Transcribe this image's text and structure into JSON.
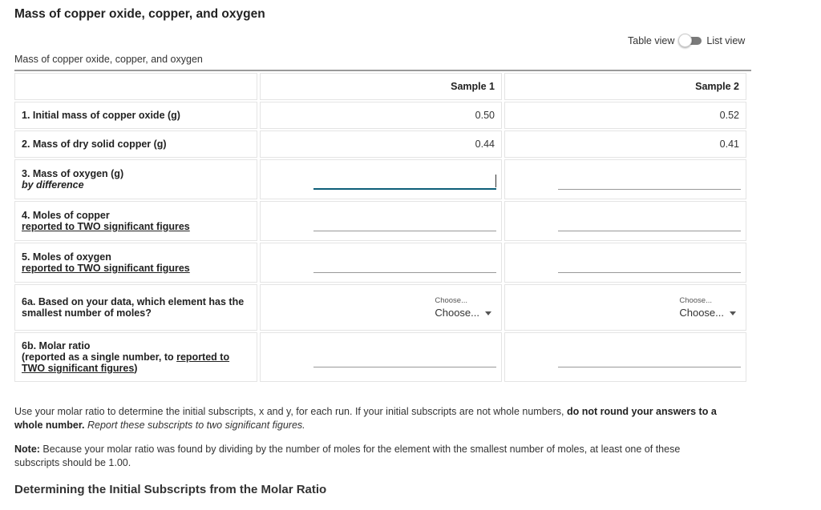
{
  "page": {
    "title": "Mass of copper oxide, copper, and oxygen"
  },
  "view_toggle": {
    "left_label": "Table view",
    "right_label": "List view",
    "state": "table"
  },
  "table": {
    "caption": "Mass of copper oxide, copper, and oxygen",
    "columns": [
      "",
      "Sample 1",
      "Sample 2"
    ],
    "rows": [
      {
        "label": "1. Initial mass of copper oxide (g)",
        "sample1": "0.50",
        "sample2": "0.52"
      },
      {
        "label": "2. Mass of dry solid copper (g)",
        "sample1": "0.44",
        "sample2": "0.41"
      },
      {
        "label": "3. Mass of oxygen (g)",
        "sublabel": "by difference",
        "sample1": "",
        "sample2": ""
      },
      {
        "label": "4. Moles of copper",
        "sublabel": "reported to TWO significant figures",
        "sample1": "",
        "sample2": ""
      },
      {
        "label": "5. Moles of oxygen",
        "sublabel": "reported to TWO significant figures",
        "sample1": "",
        "sample2": ""
      },
      {
        "label": "6a. Based on your data, which element has the smallest number of moles?",
        "sample1_select": {
          "mini_label": "Choose...",
          "value": "Choose..."
        },
        "sample2_select": {
          "mini_label": "Choose...",
          "value": "Choose..."
        }
      },
      {
        "label": "6b. Molar ratio",
        "sublabel_pre": "(reported as a single number, to ",
        "sublabel_link": "reported to TWO significant figures",
        "sublabel_post": ")",
        "sample1": "",
        "sample2": ""
      }
    ]
  },
  "instructions": {
    "p1_text": "Use your molar ratio to determine the initial subscripts, x and y, for each run. If your initial subscripts are not whole numbers, ",
    "p1_bold": "do not round your answers to a whole number.",
    "p1_italic": " Report these subscripts to two significant figures.",
    "p2_bold": "Note:",
    "p2_text": " Because your molar ratio was found by dividing by the number of moles for the element with the smallest number of moles, at least one of these subscripts should be 1.00."
  },
  "section": {
    "title": "Determining the Initial Subscripts from the Molar Ratio"
  }
}
